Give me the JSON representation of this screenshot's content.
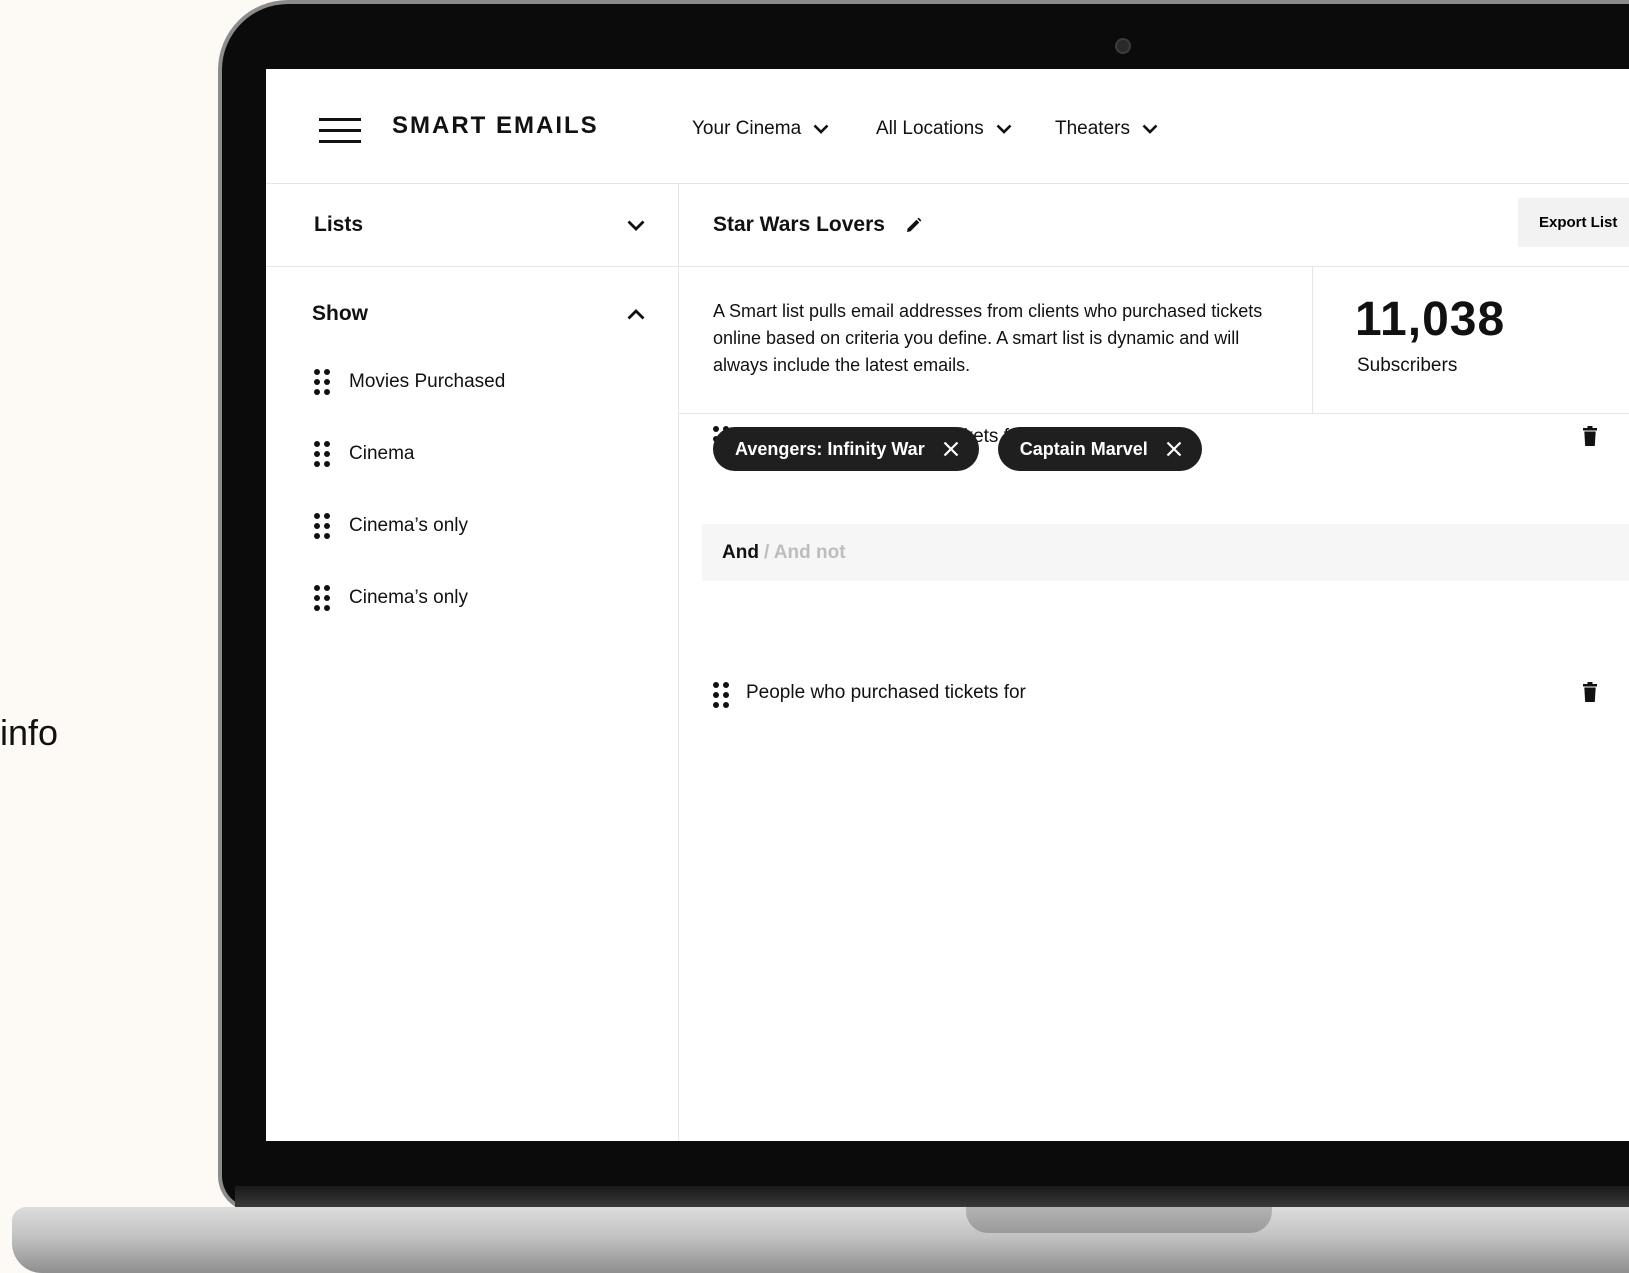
{
  "caption": "info",
  "app": {
    "brand": "SMART EMAILS",
    "nav": [
      {
        "label": "Your Cinema"
      },
      {
        "label": "All Locations"
      },
      {
        "label": "Theaters"
      }
    ]
  },
  "sidebar": {
    "lists_label": "Lists",
    "show_label": "Show",
    "items": [
      {
        "label": "Movies Purchased"
      },
      {
        "label": "Cinema"
      },
      {
        "label": "Cinema’s only"
      },
      {
        "label": "Cinema’s only"
      }
    ]
  },
  "main": {
    "title": "Star Wars Lovers",
    "export_label": "Export List",
    "description": "A Smart list pulls email addresses from clients who purchased tickets online based on criteria you define. A smart list is dynamic and will always include the latest emails.",
    "subscriber_count": "11,038",
    "subscriber_label": "Subscribers",
    "rules": [
      {
        "label": "People who purchased tickets for",
        "chips": [
          "Avengers: Infinity War",
          "Captain Marvel"
        ]
      },
      {
        "label": "People who purchased tickets for"
      }
    ],
    "operator": {
      "active": "And",
      "inactive": "/ And not"
    }
  }
}
